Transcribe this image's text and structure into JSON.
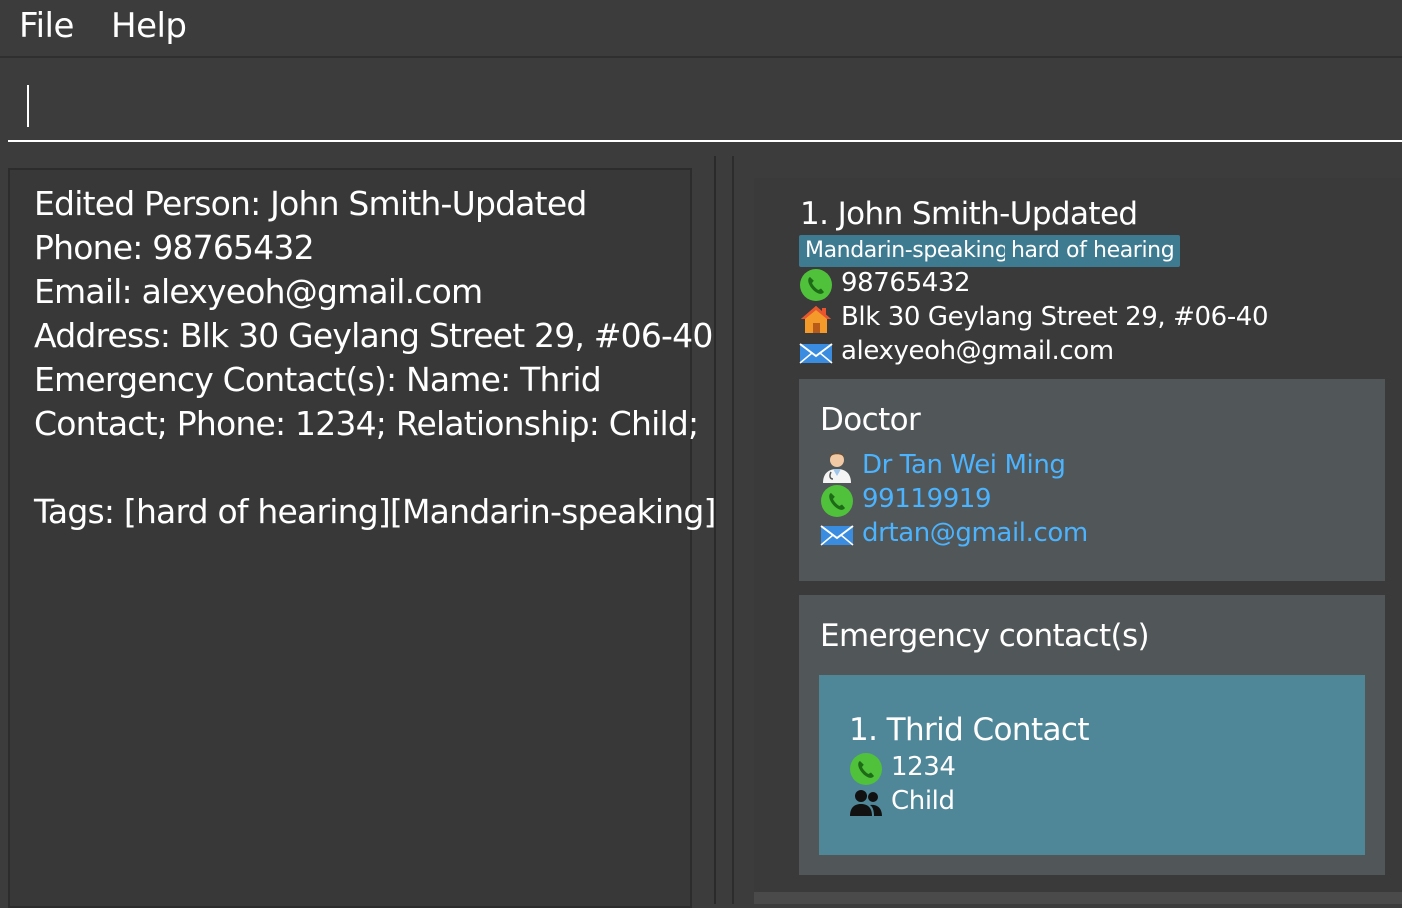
{
  "menu": {
    "file": "File",
    "help": "Help"
  },
  "command": {
    "value": ""
  },
  "result": {
    "lines": [
      "Edited Person: John Smith-Updated",
      "Phone: 98765432",
      "Email: alexyeoh@gmail.com",
      "Address: Blk 30 Geylang Street 29, #06-40",
      "Emergency Contact(s): Name: Thrid",
      "Contact; Phone: 1234; Relationship: Child;",
      "",
      "Tags: [hard of hearing][Mandarin-speaking]"
    ]
  },
  "person": {
    "name": "1. John Smith-Updated",
    "tags": [
      "Mandarin-speaking",
      "hard of hearing"
    ],
    "phone": "98765432",
    "address": "Blk 30 Geylang Street 29, #06-40",
    "email": "alexyeoh@gmail.com"
  },
  "doctor": {
    "title": "Doctor",
    "name": "Dr Tan Wei Ming",
    "phone": "99119919",
    "email": "drtan@gmail.com"
  },
  "emergency": {
    "title": "Emergency contact(s)",
    "contacts": [
      {
        "name": "1. Thrid Contact",
        "phone": "1234",
        "relationship": "Child"
      }
    ]
  },
  "icons": {
    "phone": "phone-icon",
    "home": "home-icon",
    "email": "email-icon",
    "doctor": "doctor-icon",
    "relationship": "people-icon"
  },
  "colors": {
    "tag": "#3e7b91",
    "link": "#4cb3ff",
    "emergency_card": "#4f8799",
    "section_box": "#515658"
  }
}
